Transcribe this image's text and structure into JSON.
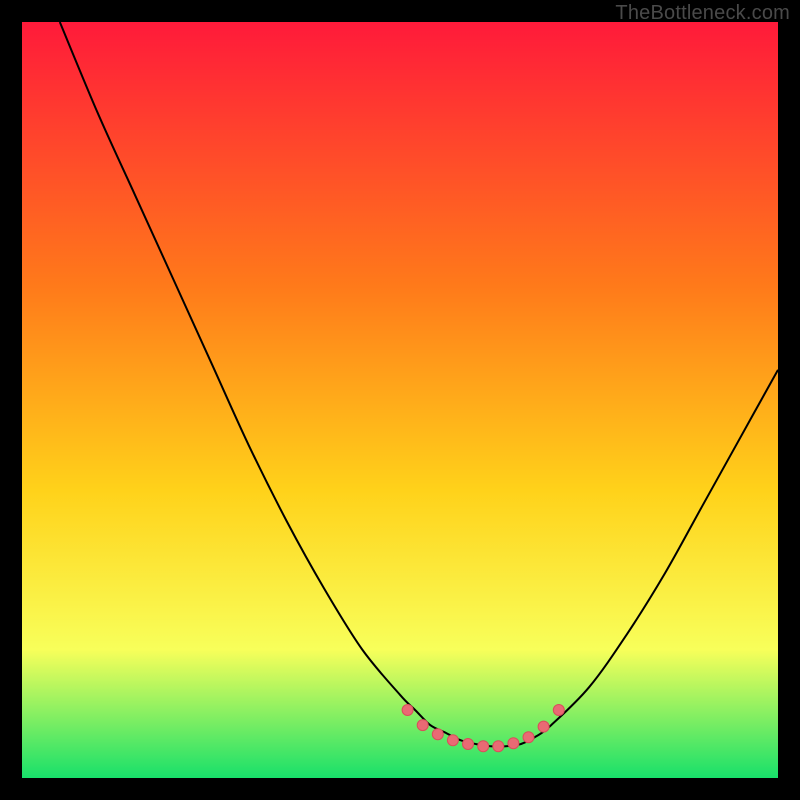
{
  "watermark": "TheBottleneck.com",
  "colors": {
    "curve": "#000000",
    "markers_fill": "#e96a74",
    "markers_stroke": "#d94f5b",
    "grad_top": "#ff1a3a",
    "grad_mid1": "#ff7a1a",
    "grad_mid2": "#ffd21a",
    "grad_mid3": "#f8ff5a",
    "grad_bottom": "#18e06a"
  },
  "chart_data": {
    "type": "line",
    "title": "",
    "xlabel": "",
    "ylabel": "",
    "xlim": [
      0,
      100
    ],
    "ylim": [
      0,
      100
    ],
    "annotations": [],
    "series": [
      {
        "name": "curve",
        "x": [
          5,
          10,
          15,
          20,
          25,
          30,
          35,
          40,
          45,
          50,
          52,
          54,
          56,
          58,
          60,
          62,
          64,
          66,
          68,
          70,
          75,
          80,
          85,
          90,
          95,
          100
        ],
        "values": [
          100,
          88,
          77,
          66,
          55,
          44,
          34,
          25,
          17,
          11,
          9,
          7,
          6,
          5,
          4.5,
          4.2,
          4.2,
          4.5,
          5.5,
          7,
          12,
          19,
          27,
          36,
          45,
          54
        ]
      }
    ],
    "markers": {
      "x": [
        51,
        53,
        55,
        57,
        59,
        61,
        63,
        65,
        67,
        69,
        71
      ],
      "values": [
        9,
        7,
        5.8,
        5,
        4.5,
        4.2,
        4.2,
        4.6,
        5.4,
        6.8,
        9
      ]
    }
  }
}
